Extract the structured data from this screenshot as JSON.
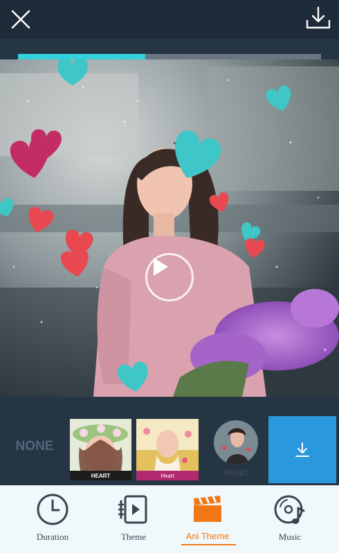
{
  "topbar": {
    "close_icon": "close-icon",
    "download_icon": "download-icon"
  },
  "playback": {
    "progress_fraction": 0.42,
    "play_icon": "play-icon"
  },
  "theme_strip": {
    "none_label": "NONE",
    "items": [
      {
        "label": "HEART"
      },
      {
        "label": "Heart"
      },
      {
        "label": "Heart"
      }
    ],
    "download_tile_icon": "download-arrow-icon"
  },
  "tabs": [
    {
      "label": "Duration",
      "icon": "clock-icon"
    },
    {
      "label": "Theme",
      "icon": "theme-icon"
    },
    {
      "label": "Ani Theme",
      "icon": "clapperboard-icon",
      "active": true
    },
    {
      "label": "Music",
      "icon": "music-disc-icon"
    }
  ],
  "colors": {
    "accent": "#f07814",
    "progress": "#35d0de",
    "download_tile": "#2a98dd",
    "heart_teal": "#3fc6c6",
    "heart_red": "#e8484f",
    "heart_magenta": "#c42d63"
  }
}
